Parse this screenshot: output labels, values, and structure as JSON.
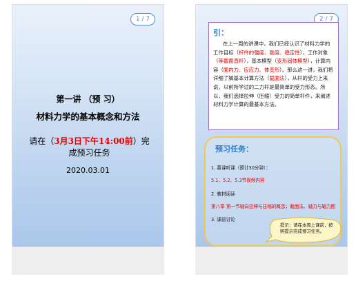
{
  "left_slide": {
    "page": "1 / 7",
    "title": "第一讲   （预  习）",
    "subtitle": "材料力学的基本概念和方法",
    "deadline_prefix": "请在（",
    "deadline_highlight": "3月3日下午14:00前",
    "deadline_suffix": "）完成预习任务",
    "date": "2020.03.01"
  },
  "right_slide": {
    "page": "2 / 7",
    "intro": {
      "heading": "引：",
      "segments": [
        {
          "t": "在上一周的讲课中，我们已经认识了材料力学的工作目标（",
          "red": false
        },
        {
          "t": "杆件的强度、刚度、稳定性",
          "red": true
        },
        {
          "t": "），工作对象（",
          "red": false
        },
        {
          "t": "等截面直杆",
          "red": true
        },
        {
          "t": "），基本模型（",
          "red": false
        },
        {
          "t": "变形固体模型",
          "red": true
        },
        {
          "t": "），计算内容（",
          "red": false
        },
        {
          "t": "面内力、应应力、体变形",
          "red": true
        },
        {
          "t": "）。那么这一讲，我们将详细了解基本计算方法（",
          "red": false
        },
        {
          "t": "截面法",
          "red": true
        },
        {
          "t": "），从杆的受力上来说，以前所学过的二力杆是最简单的受力形态。所以，我们选择拉伸（压缩）受力的简单杆件，来阐述材料力学计算的最基本方法。",
          "red": false
        }
      ]
    },
    "tasks": {
      "heading": "预习任务：",
      "items": [
        {
          "text": "1. 慕课听课（预计30分钟）：",
          "red": false
        },
        {
          "text": "5.1、5.2、5.3节视频内容",
          "red": true
        },
        {
          "text": "2. 教材阅读",
          "red": false
        },
        {
          "text": "第八章 第一节轴向拉伸与压缩的概念；截面法、轴力与轴力图",
          "red": true
        },
        {
          "text": "3. 课前讨论",
          "red": false
        }
      ],
      "callout": "提示：请在本周上课前，按照提示完成预习任务。"
    }
  }
}
